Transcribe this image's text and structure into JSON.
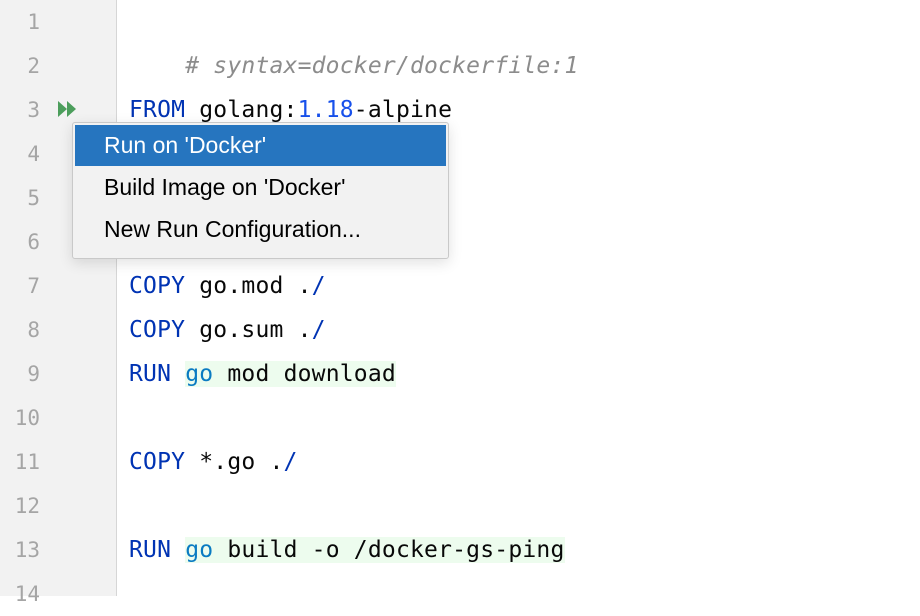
{
  "editor": {
    "line_numbers": [
      "1",
      "2",
      "3",
      "4",
      "5",
      "6",
      "7",
      "8",
      "9",
      "10",
      "11",
      "12",
      "13",
      "14"
    ],
    "lines": {
      "l1": {
        "comment": "# syntax=docker/dockerfile:1"
      },
      "l3": {
        "kw": "FROM",
        "pre": " golang:",
        "num": "1.18",
        "post": "-alpine"
      },
      "l7": {
        "kw": "COPY",
        "text": " go.mod .",
        "slash": "/"
      },
      "l8": {
        "kw": "COPY",
        "text": " go.sum .",
        "slash": "/"
      },
      "l9": {
        "kw": "RUN",
        "sp": " ",
        "go": "go",
        "rest": " mod download"
      },
      "l11": {
        "kw": "COPY",
        "text": " *.go .",
        "slash": "/"
      },
      "l13": {
        "kw": "RUN",
        "sp": " ",
        "go": "go",
        "rest": " build -o /docker-gs-ping"
      }
    },
    "run_gutter_icon": "run-double-triangle-icon",
    "colors": {
      "keyword": "#0033b3",
      "comment": "#8c8c8c",
      "number": "#1750eb",
      "shell_command": "#0a7bc2",
      "shell_background": "#edfcee",
      "run_icon": "#4c9e5c"
    }
  },
  "context_menu": {
    "items": [
      {
        "label": "Run on 'Docker'",
        "selected": true
      },
      {
        "label": "Build Image on 'Docker'",
        "selected": false
      },
      {
        "label": "New Run Configuration...",
        "selected": false
      }
    ],
    "selection_color": "#2675bf"
  }
}
